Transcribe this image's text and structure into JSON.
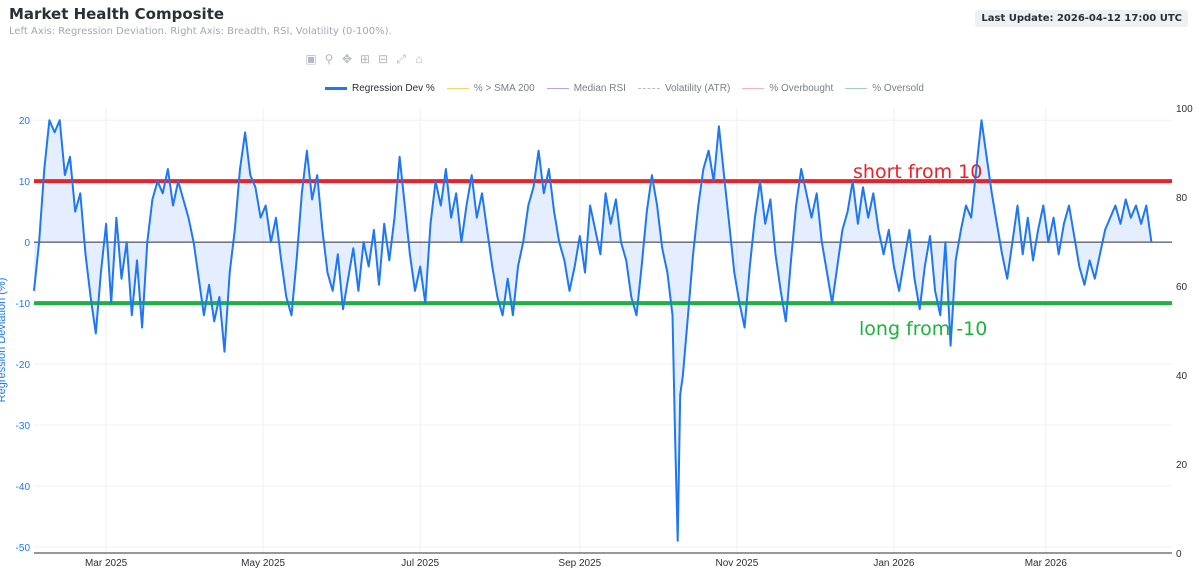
{
  "header": {
    "title": "Market Health Composite",
    "subtitle": "Left Axis: Regression Deviation. Right Axis: Breadth, RSI, Volatility (0-100%).",
    "last_update": "Last Update: 2026-04-12 17:00 UTC"
  },
  "modebar": [
    "camera-icon",
    "zoom-icon",
    "pan-icon",
    "zoom-in-icon",
    "zoom-out-icon",
    "autoscale-icon",
    "home-icon"
  ],
  "legend": [
    {
      "label": "Regression Dev %",
      "color": "#1f77f4",
      "style": "solid-thick"
    },
    {
      "label": "% > SMA 200",
      "color": "#f3d36b",
      "style": "solid"
    },
    {
      "label": "Median RSI",
      "color": "#b8a2ea",
      "style": "solid"
    },
    {
      "label": "Volatility (ATR)",
      "color": "#b9bcc2",
      "style": "dashed"
    },
    {
      "label": "% Overbought",
      "color": "#f2b8b8",
      "style": "solid"
    },
    {
      "label": "% Oversold",
      "color": "#9fd4b2",
      "style": "solid"
    }
  ],
  "annotations": {
    "short": {
      "text": "short from 10",
      "y": 10,
      "color": "#e8222a"
    },
    "long": {
      "text": "long from -10",
      "y": -10,
      "color": "#1db23f"
    }
  },
  "chart_data": {
    "type": "line",
    "title": "Market Health Composite",
    "ylabel": "Regression Deviation (%)",
    "ylim": [
      -51,
      22
    ],
    "y2lim": [
      0,
      100
    ],
    "yticks": [
      20,
      10,
      0,
      -10,
      -20,
      -30,
      -40,
      -50
    ],
    "y2ticks": [
      100,
      80,
      60,
      40,
      20,
      0
    ],
    "xlim": [
      "2025-02-01",
      "2026-04-19"
    ],
    "xticks": [
      {
        "date": "2025-03-01",
        "label": "Mar 2025"
      },
      {
        "date": "2025-05-01",
        "label": "May 2025"
      },
      {
        "date": "2025-07-01",
        "label": "Jul 2025"
      },
      {
        "date": "2025-09-01",
        "label": "Sep 2025"
      },
      {
        "date": "2025-11-01",
        "label": "Nov 2025"
      },
      {
        "date": "2026-01-01",
        "label": "Jan 2026"
      },
      {
        "date": "2026-03-01",
        "label": "Mar 2026"
      }
    ],
    "grid": true,
    "legend_position": "top",
    "reference_lines": [
      {
        "y": 10,
        "color": "#e8222a"
      },
      {
        "y": -10,
        "color": "#1db23f"
      },
      {
        "y": 0,
        "color": "#2b2f36"
      }
    ],
    "series": [
      {
        "name": "Regression Dev %",
        "color": "#1f77f4",
        "points": [
          [
            "2025-02-01",
            -8
          ],
          [
            "2025-02-03",
            0
          ],
          [
            "2025-02-05",
            12
          ],
          [
            "2025-02-07",
            20
          ],
          [
            "2025-02-09",
            18
          ],
          [
            "2025-02-11",
            20
          ],
          [
            "2025-02-13",
            11
          ],
          [
            "2025-02-15",
            14
          ],
          [
            "2025-02-17",
            5
          ],
          [
            "2025-02-19",
            8
          ],
          [
            "2025-02-21",
            -2
          ],
          [
            "2025-02-23",
            -9
          ],
          [
            "2025-02-25",
            -15
          ],
          [
            "2025-02-27",
            -5
          ],
          [
            "2025-03-01",
            3
          ],
          [
            "2025-03-03",
            -10
          ],
          [
            "2025-03-05",
            4
          ],
          [
            "2025-03-07",
            -6
          ],
          [
            "2025-03-09",
            0
          ],
          [
            "2025-03-11",
            -12
          ],
          [
            "2025-03-13",
            -3
          ],
          [
            "2025-03-15",
            -14
          ],
          [
            "2025-03-17",
            0
          ],
          [
            "2025-03-19",
            7
          ],
          [
            "2025-03-21",
            10
          ],
          [
            "2025-03-23",
            8
          ],
          [
            "2025-03-25",
            12
          ],
          [
            "2025-03-27",
            6
          ],
          [
            "2025-03-29",
            10
          ],
          [
            "2025-03-31",
            7
          ],
          [
            "2025-04-02",
            4
          ],
          [
            "2025-04-04",
            0
          ],
          [
            "2025-04-06",
            -6
          ],
          [
            "2025-04-08",
            -12
          ],
          [
            "2025-04-10",
            -7
          ],
          [
            "2025-04-12",
            -13
          ],
          [
            "2025-04-14",
            -9
          ],
          [
            "2025-04-16",
            -18
          ],
          [
            "2025-04-18",
            -5
          ],
          [
            "2025-04-20",
            2
          ],
          [
            "2025-04-22",
            12
          ],
          [
            "2025-04-24",
            18
          ],
          [
            "2025-04-26",
            11
          ],
          [
            "2025-04-28",
            9
          ],
          [
            "2025-04-30",
            4
          ],
          [
            "2025-05-02",
            6
          ],
          [
            "2025-05-04",
            0
          ],
          [
            "2025-05-06",
            4
          ],
          [
            "2025-05-08",
            -3
          ],
          [
            "2025-05-10",
            -9
          ],
          [
            "2025-05-12",
            -12
          ],
          [
            "2025-05-14",
            -3
          ],
          [
            "2025-05-16",
            8
          ],
          [
            "2025-05-18",
            15
          ],
          [
            "2025-05-20",
            7
          ],
          [
            "2025-05-22",
            11
          ],
          [
            "2025-05-24",
            2
          ],
          [
            "2025-05-26",
            -5
          ],
          [
            "2025-05-28",
            -8
          ],
          [
            "2025-05-30",
            -2
          ],
          [
            "2025-06-01",
            -11
          ],
          [
            "2025-06-03",
            -6
          ],
          [
            "2025-06-05",
            -1
          ],
          [
            "2025-06-07",
            -8
          ],
          [
            "2025-06-09",
            0
          ],
          [
            "2025-06-11",
            -4
          ],
          [
            "2025-06-13",
            2
          ],
          [
            "2025-06-15",
            -7
          ],
          [
            "2025-06-17",
            3
          ],
          [
            "2025-06-19",
            -3
          ],
          [
            "2025-06-21",
            4
          ],
          [
            "2025-06-23",
            14
          ],
          [
            "2025-06-25",
            6
          ],
          [
            "2025-06-27",
            -2
          ],
          [
            "2025-06-29",
            -8
          ],
          [
            "2025-07-01",
            -4
          ],
          [
            "2025-07-03",
            -10
          ],
          [
            "2025-07-05",
            3
          ],
          [
            "2025-07-07",
            10
          ],
          [
            "2025-07-09",
            6
          ],
          [
            "2025-07-11",
            12
          ],
          [
            "2025-07-13",
            4
          ],
          [
            "2025-07-15",
            8
          ],
          [
            "2025-07-17",
            0
          ],
          [
            "2025-07-19",
            6
          ],
          [
            "2025-07-21",
            11
          ],
          [
            "2025-07-23",
            4
          ],
          [
            "2025-07-25",
            8
          ],
          [
            "2025-07-27",
            2
          ],
          [
            "2025-07-29",
            -4
          ],
          [
            "2025-07-31",
            -9
          ],
          [
            "2025-08-02",
            -12
          ],
          [
            "2025-08-04",
            -6
          ],
          [
            "2025-08-06",
            -12
          ],
          [
            "2025-08-08",
            -4
          ],
          [
            "2025-08-10",
            0
          ],
          [
            "2025-08-12",
            6
          ],
          [
            "2025-08-14",
            9
          ],
          [
            "2025-08-16",
            15
          ],
          [
            "2025-08-18",
            8
          ],
          [
            "2025-08-20",
            12
          ],
          [
            "2025-08-22",
            5
          ],
          [
            "2025-08-24",
            0
          ],
          [
            "2025-08-26",
            -3
          ],
          [
            "2025-08-28",
            -8
          ],
          [
            "2025-08-30",
            -4
          ],
          [
            "2025-09-01",
            1
          ],
          [
            "2025-09-03",
            -5
          ],
          [
            "2025-09-05",
            6
          ],
          [
            "2025-09-07",
            2
          ],
          [
            "2025-09-09",
            -2
          ],
          [
            "2025-09-11",
            8
          ],
          [
            "2025-09-13",
            3
          ],
          [
            "2025-09-15",
            7
          ],
          [
            "2025-09-17",
            0
          ],
          [
            "2025-09-19",
            -3
          ],
          [
            "2025-09-21",
            -9
          ],
          [
            "2025-09-23",
            -12
          ],
          [
            "2025-09-25",
            -4
          ],
          [
            "2025-09-27",
            5
          ],
          [
            "2025-09-29",
            11
          ],
          [
            "2025-10-01",
            6
          ],
          [
            "2025-10-03",
            -1
          ],
          [
            "2025-10-05",
            -5
          ],
          [
            "2025-10-07",
            -12
          ],
          [
            "2025-10-08",
            -32
          ],
          [
            "2025-10-09",
            -49
          ],
          [
            "2025-10-10",
            -25
          ],
          [
            "2025-10-11",
            -22
          ],
          [
            "2025-10-13",
            -12
          ],
          [
            "2025-10-15",
            -2
          ],
          [
            "2025-10-17",
            6
          ],
          [
            "2025-10-19",
            12
          ],
          [
            "2025-10-21",
            15
          ],
          [
            "2025-10-23",
            10
          ],
          [
            "2025-10-25",
            19
          ],
          [
            "2025-10-27",
            11
          ],
          [
            "2025-10-29",
            3
          ],
          [
            "2025-10-31",
            -5
          ],
          [
            "2025-11-02",
            -10
          ],
          [
            "2025-11-04",
            -14
          ],
          [
            "2025-11-06",
            -4
          ],
          [
            "2025-11-08",
            4
          ],
          [
            "2025-11-10",
            10
          ],
          [
            "2025-11-12",
            3
          ],
          [
            "2025-11-14",
            7
          ],
          [
            "2025-11-16",
            -2
          ],
          [
            "2025-11-18",
            -8
          ],
          [
            "2025-11-20",
            -13
          ],
          [
            "2025-11-22",
            -3
          ],
          [
            "2025-11-24",
            6
          ],
          [
            "2025-11-26",
            12
          ],
          [
            "2025-11-28",
            8
          ],
          [
            "2025-11-30",
            4
          ],
          [
            "2025-12-02",
            8
          ],
          [
            "2025-12-04",
            0
          ],
          [
            "2025-12-06",
            -5
          ],
          [
            "2025-12-08",
            -10
          ],
          [
            "2025-12-10",
            -4
          ],
          [
            "2025-12-12",
            2
          ],
          [
            "2025-12-14",
            5
          ],
          [
            "2025-12-16",
            10
          ],
          [
            "2025-12-18",
            3
          ],
          [
            "2025-12-20",
            9
          ],
          [
            "2025-12-22",
            4
          ],
          [
            "2025-12-24",
            8
          ],
          [
            "2025-12-26",
            2
          ],
          [
            "2025-12-28",
            -2
          ],
          [
            "2025-12-30",
            2
          ],
          [
            "2026-01-01",
            -4
          ],
          [
            "2026-01-03",
            -8
          ],
          [
            "2026-01-05",
            -3
          ],
          [
            "2026-01-07",
            2
          ],
          [
            "2026-01-09",
            -6
          ],
          [
            "2026-01-11",
            -11
          ],
          [
            "2026-01-13",
            -4
          ],
          [
            "2026-01-15",
            1
          ],
          [
            "2026-01-17",
            -8
          ],
          [
            "2026-01-19",
            -12
          ],
          [
            "2026-01-21",
            0
          ],
          [
            "2026-01-23",
            -17
          ],
          [
            "2026-01-25",
            -3
          ],
          [
            "2026-01-27",
            2
          ],
          [
            "2026-01-29",
            6
          ],
          [
            "2026-01-31",
            4
          ],
          [
            "2026-02-02",
            12
          ],
          [
            "2026-02-04",
            20
          ],
          [
            "2026-02-06",
            14
          ],
          [
            "2026-02-08",
            8
          ],
          [
            "2026-02-10",
            3
          ],
          [
            "2026-02-12",
            -2
          ],
          [
            "2026-02-14",
            -6
          ],
          [
            "2026-02-16",
            0
          ],
          [
            "2026-02-18",
            6
          ],
          [
            "2026-02-20",
            -2
          ],
          [
            "2026-02-22",
            4
          ],
          [
            "2026-02-24",
            -3
          ],
          [
            "2026-02-26",
            2
          ],
          [
            "2026-02-28",
            6
          ],
          [
            "2026-03-02",
            0
          ],
          [
            "2026-03-04",
            4
          ],
          [
            "2026-03-06",
            -2
          ],
          [
            "2026-03-08",
            3
          ],
          [
            "2026-03-10",
            6
          ],
          [
            "2026-03-12",
            1
          ],
          [
            "2026-03-14",
            -4
          ],
          [
            "2026-03-16",
            -7
          ],
          [
            "2026-03-18",
            -3
          ],
          [
            "2026-03-20",
            -6
          ],
          [
            "2026-03-22",
            -2
          ],
          [
            "2026-03-24",
            2
          ],
          [
            "2026-03-26",
            4
          ],
          [
            "2026-03-28",
            6
          ],
          [
            "2026-03-30",
            3
          ],
          [
            "2026-04-01",
            7
          ],
          [
            "2026-04-03",
            4
          ],
          [
            "2026-04-05",
            6
          ],
          [
            "2026-04-07",
            3
          ],
          [
            "2026-04-09",
            6
          ],
          [
            "2026-04-11",
            0
          ]
        ]
      }
    ]
  }
}
